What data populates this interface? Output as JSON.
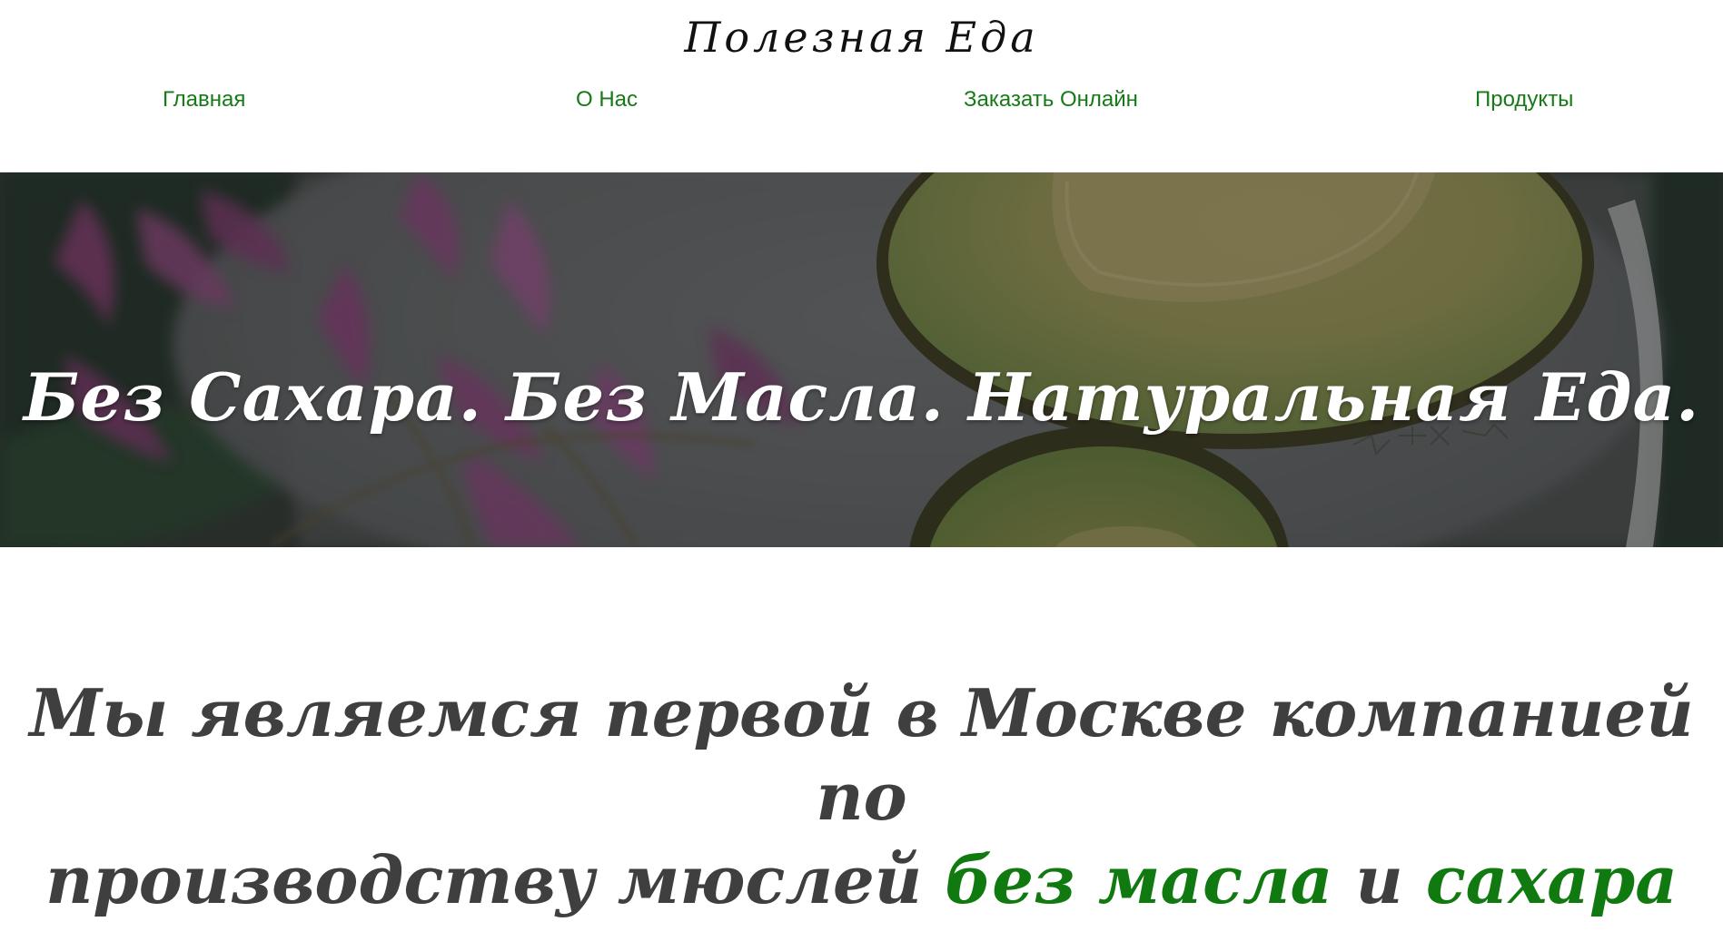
{
  "site": {
    "logo": "Полезная Еда"
  },
  "nav": {
    "home": "Главная",
    "about": "О Нас",
    "order": "Заказать Онлайн",
    "products": "Продукты"
  },
  "hero": {
    "title": "Без Сахара. Без Масла. Натуральная Еда."
  },
  "about": {
    "line1": "Мы являемся первой в Москве компанией по",
    "line2_part1": "производству мюслей ",
    "highlight1": "без масла",
    "connector": " и ",
    "highlight2": "сахара"
  },
  "colors": {
    "nav_link": "#167a16",
    "highlight": "#107a10",
    "tagline_text": "#3f3f3f",
    "hero_text": "#ffffff"
  }
}
